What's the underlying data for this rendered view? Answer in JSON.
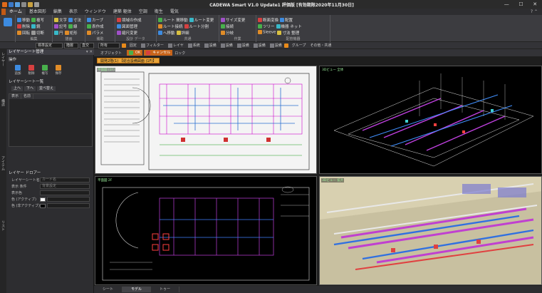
{
  "window": {
    "title": "CADEWA Smart V1.0 Update1 評価版 [有効期限2020年11月30日]",
    "min": "—",
    "max": "☐",
    "close": "✕"
  },
  "menu": {
    "file": "",
    "tabs": [
      "ホーム",
      "基本図形",
      "編集",
      "表示",
      "ウィンドウ",
      "建築 躯体",
      "空調",
      "衛生",
      "電気"
    ]
  },
  "ribbon": {
    "groups": [
      {
        "label": "編集"
      },
      {
        "label": "描画"
      },
      {
        "label": "補助"
      },
      {
        "label": "設計 データ"
      },
      {
        "label": "共通"
      },
      {
        "label": "作業"
      },
      {
        "label": "配管機器"
      }
    ],
    "g1": [
      "移動",
      "複写",
      "削除",
      "鏡",
      "回転",
      "切断"
    ],
    "g2": [
      "文字",
      "寸法",
      "記号",
      "線",
      "円",
      "矩形"
    ],
    "g3": [
      "カーブ",
      "表作成",
      "パラメ"
    ],
    "g4": [
      "領域の作成",
      "図面管理",
      "縮尺変更"
    ],
    "g5": [
      "ルート 間移動",
      "ルート変更",
      "ルート接続",
      "ルート分割",
      "へ移動",
      "詳細"
    ],
    "g6": [
      "サイズ変更",
      "接続",
      "分岐"
    ],
    "g7": [
      "断面変換",
      "配置",
      "ツリー",
      "機器 ネット",
      "Sleeve",
      "寸法 整理"
    ]
  },
  "toolbar": {
    "combo1": "標準設定",
    "combo2": "階層",
    "combo3": "直交",
    "combo4": "所有",
    "lock_label": "固定",
    "filter_label": "フィルター",
    "btns": [
      "レイヤ",
      "系統",
      "設備",
      "設備",
      "設備",
      "設備",
      "設備"
    ],
    "group_label": "グループ",
    "other_label": "その他・共通"
  },
  "toolbar2": {
    "label1": "オブジェクト",
    "ok": "OK",
    "cancel": "キャンセル",
    "mode": "ロック"
  },
  "leftpanel": {
    "vtabs": [
      "レイヤー",
      "構造",
      "アイテム",
      "リスト"
    ],
    "header": "レイヤーシート管理",
    "sec1": "操作",
    "btns": [
      "追加",
      "削除",
      "複写",
      "保存"
    ],
    "sec2": "レイヤーシート一覧",
    "lytabs": [
      "上へ",
      "下へ",
      "並べ替え"
    ],
    "table_head": [
      "表示",
      "名前"
    ],
    "sec3": "レイヤー ドロアー",
    "props": [
      {
        "label": "レイヤーシート名",
        "value": "カード名"
      },
      {
        "label": "表示 条件",
        "value": "背景設定"
      },
      {
        "label": "表示色",
        "value": ""
      },
      {
        "label": "色 (アクティブ)",
        "value": ""
      },
      {
        "label": "色 (非アクティブ)",
        "value": ""
      }
    ]
  },
  "document": {
    "tab": "開発2階(1) 【総合設備図面 (1F)】",
    "views": [
      "平面図 (1F)",
      "3Dビュー 全体",
      "平面図 2F",
      "3Dビュー 拡大"
    ]
  },
  "bottom": {
    "tabs": [
      "シート",
      "モデル",
      "トゥー"
    ]
  }
}
